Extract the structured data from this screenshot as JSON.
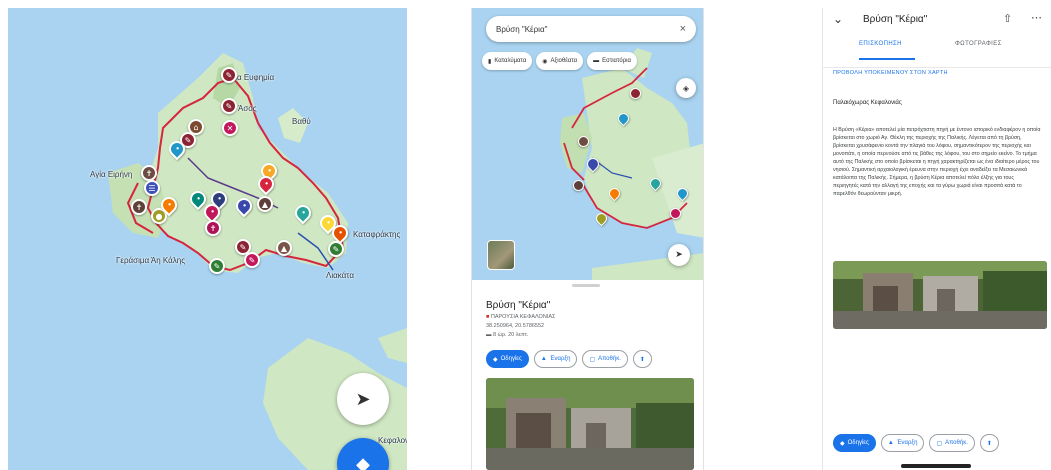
{
  "panel_map": {
    "labels": {
      "town_1": "Αγία Ευφημία",
      "town_2": "Άσος",
      "town_3": "Βαθύ",
      "town_4": "Αγία Ειρήνη",
      "town_5": "Καταφράκτης",
      "town_6": "Λιακάτα",
      "town_7": "Γεράσιμα Άη Κάλης",
      "town_8": "Κεφαλονιά"
    },
    "buttons": {
      "navigate_icon": "navigation-arrow-icon",
      "directions_icon": "directions-icon"
    }
  },
  "panel_phone": {
    "search": {
      "value": "Βρύση \"Κέρια\"",
      "clear": "×"
    },
    "chips": [
      {
        "label": "Καταλύματα",
        "icon": "▮"
      },
      {
        "label": "Αξιοθέατα",
        "icon": "◉"
      },
      {
        "label": "Εστιατόρια",
        "icon": "▬"
      }
    ],
    "place": {
      "title": "Βρύση \"Κέρια\"",
      "category": "ΠΑΡΟΥΣΙΑ ΚΕΦΑΛΟΝΙΑΣ",
      "coords": "38.250964, 20.5786552",
      "drive": "8 ώρ. 20 λεπτ."
    },
    "actions": [
      {
        "label": "Οδηγίες",
        "icon": "◆"
      },
      {
        "label": "Έναρξη",
        "icon": "▲"
      },
      {
        "label": "Αποθήκ.",
        "icon": "▢"
      },
      {
        "label": "",
        "icon": "⬆"
      }
    ]
  },
  "panel_details": {
    "header": {
      "title": "Βρύση \"Κέρια\"",
      "chevron": "⌄",
      "share": "⇧",
      "more": "⋯"
    },
    "tabs": [
      "ΕΠΙΣΚΟΠΗΣΗ",
      "ΦΩΤΟΓΡΑΦΙΕΣ"
    ],
    "link": "ΠΡΟΒΟΛΗ ΥΠΟΚΕΙΜΕΝΟΥ ΣΤΟΝ ΧΑΡΤΗ",
    "section_title": "Παλαιόχωρας Κεφαλονιάς",
    "body": "Η Βρύση «Κέρια» αποτελεί μία πετρόχτιστη πηγή με έντονο ιστορικό ενδιαφέρον η οποία βρίσκεται στο χωριό Αγ. Θέκλη της περιοχής της Παλικής. Λέγεται από τη βρύση, βρίσκεται χρυσάφενιο κοντά την πλαγιά του λόφου, σημαντικότερον της περιοχής και μονοπάτι, η οποία περνούσε από τις βάθες της λόφου, του στο σημείο εκείνο. Το τμήμα αυτό της Παλικής στο οποίο βρίσκεται η πηγή χαρακτηρίζεται ως ένα ιδιαίτερο μέρος του νησιού. Σημαντική αρχαιολογική έρευνα στην περιοχή έχει αναδείξει τα Μεσαιωνικά κατάλοιπα της Παλικής. Σήμερα, η βρύση Κέρια αποτελεί πόλο έλξης για τους περιηγητές κατά την αλλαγή της εποχής και τα γύρω χωριά είναι προσιτά κατά το παρελθόν θεωρούνταν μικρή.",
    "actions": [
      {
        "label": "Οδηγίες",
        "icon": "◆"
      },
      {
        "label": "Έναρξη",
        "icon": "▲"
      },
      {
        "label": "Αποθήκ.",
        "icon": "▢"
      },
      {
        "label": "",
        "icon": "⬆"
      }
    ]
  },
  "colors": {
    "water": "#a9d3f0",
    "land": "#cfe7c2",
    "route": "#d6263f",
    "accent": "#1a73e8"
  }
}
